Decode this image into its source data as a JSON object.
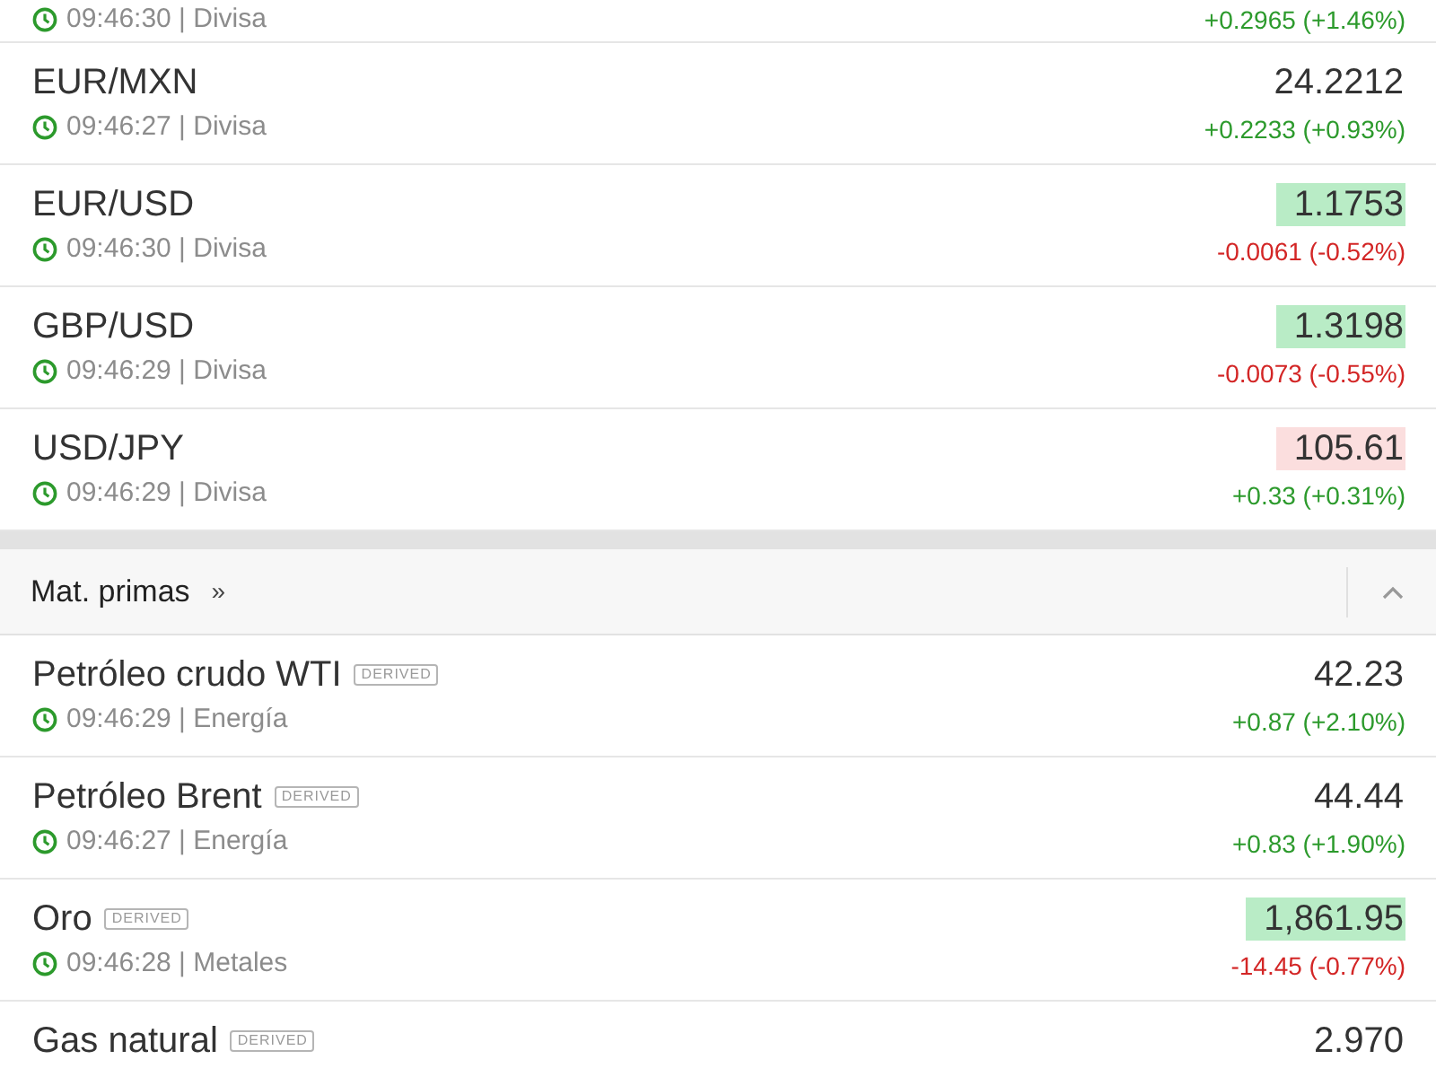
{
  "top_row": {
    "time": "09:46:30",
    "separator": "|",
    "category": "Divisa",
    "change": "+0.2965 (+1.46%)",
    "color": "#2c9a2c"
  },
  "currencies": [
    {
      "name": "EUR/MXN",
      "time": "09:46:27",
      "separator": "|",
      "category": "Divisa",
      "price": "24.2212",
      "change": "+0.2233 (+0.93%)",
      "color": "#2c9a2c"
    },
    {
      "name": "EUR/USD",
      "time": "09:46:30",
      "separator": "|",
      "category": "Divisa",
      "price": "1.1753",
      "highlight": {
        "color": "#b9ecc6"
      },
      "change": "-0.0061 (-0.52%)",
      "color": "#d32626"
    },
    {
      "name": "GBP/USD",
      "time": "09:46:29",
      "separator": "|",
      "category": "Divisa",
      "price": "1.3198",
      "highlight": {
        "color": "#b9ecc6"
      },
      "change": "-0.0073 (-0.55%)",
      "color": "#d32626"
    },
    {
      "name": "USD/JPY",
      "time": "09:46:29",
      "separator": "|",
      "category": "Divisa",
      "price": "105.61",
      "highlight": {
        "color": "#fbdede"
      },
      "change": "+0.33 (+0.31%)",
      "color": "#2c9a2c"
    }
  ],
  "section": {
    "title": "Mat. primas",
    "more": "»",
    "expanded": true
  },
  "commodities": [
    {
      "name": "Petróleo crudo WTI",
      "badge": "DERIVED",
      "time": "09:46:29",
      "separator": "|",
      "category": "Energía",
      "price": "42.23",
      "change": "+0.87 (+2.10%)",
      "color": "#2c9a2c"
    },
    {
      "name": "Petróleo Brent",
      "badge": "DERIVED",
      "time": "09:46:27",
      "separator": "|",
      "category": "Energía",
      "price": "44.44",
      "change": "+0.83 (+1.90%)",
      "color": "#2c9a2c"
    },
    {
      "name": "Oro",
      "badge": "DERIVED",
      "time": "09:46:28",
      "separator": "|",
      "category": "Metales",
      "price": "1,861.95",
      "highlight": {
        "color": "#b9ecc6"
      },
      "change": "-14.45 (-0.77%)",
      "color": "#d32626"
    }
  ],
  "bottom_row": {
    "name": "Gas natural",
    "badge": "DERIVED",
    "price": "2.970"
  }
}
